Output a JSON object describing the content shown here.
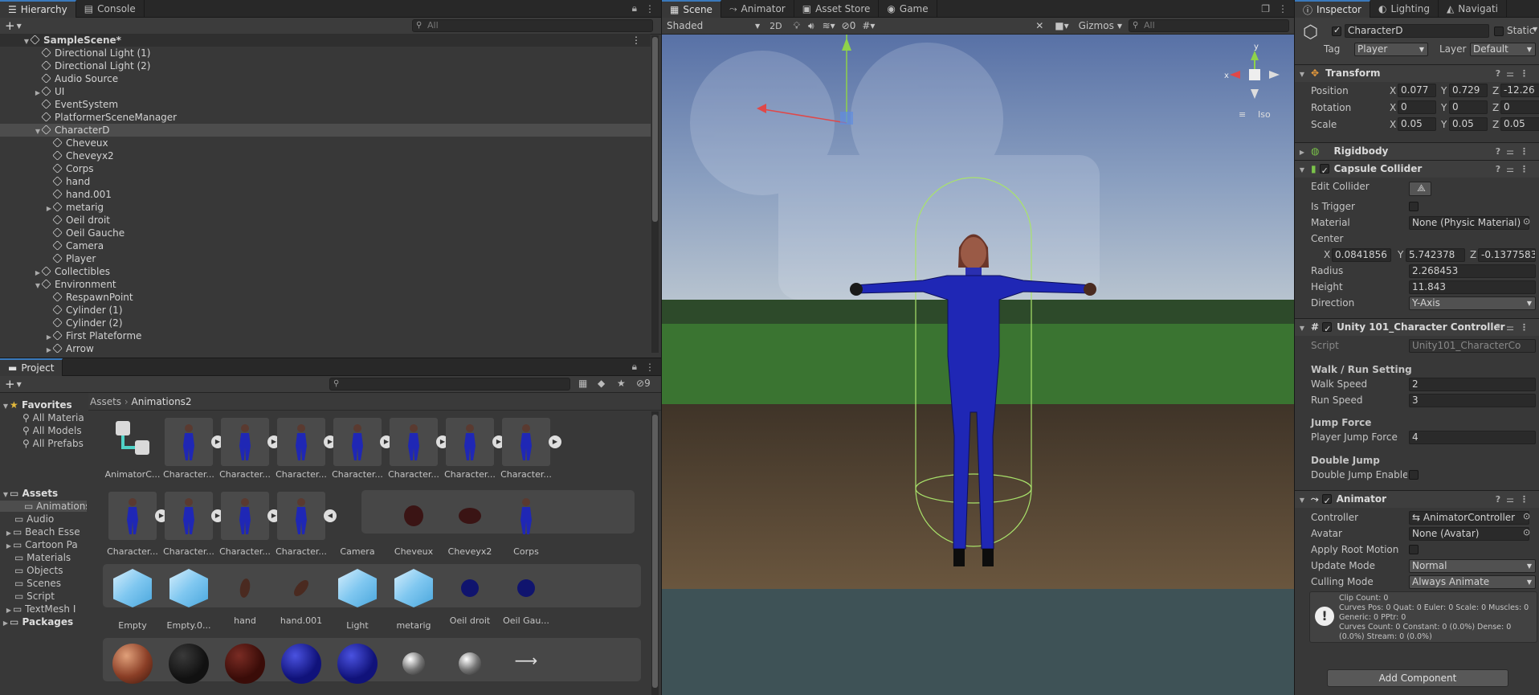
{
  "hierarchy": {
    "tabs": [
      "Hierarchy",
      "Console"
    ],
    "search_placeholder": "All",
    "items": [
      {
        "label": "SampleScene*",
        "indent": 0,
        "fold": "▼",
        "type": "scene"
      },
      {
        "label": "Directional Light (1)",
        "indent": 1,
        "fold": ""
      },
      {
        "label": "Directional Light (2)",
        "indent": 1,
        "fold": ""
      },
      {
        "label": "Audio Source",
        "indent": 1,
        "fold": ""
      },
      {
        "label": "UI",
        "indent": 1,
        "fold": "▶"
      },
      {
        "label": "EventSystem",
        "indent": 1,
        "fold": ""
      },
      {
        "label": "PlatformerSceneManager",
        "indent": 1,
        "fold": ""
      },
      {
        "label": "CharacterD",
        "indent": 1,
        "fold": "▼",
        "selected": true
      },
      {
        "label": "Cheveux",
        "indent": 2,
        "fold": ""
      },
      {
        "label": "Cheveyx2",
        "indent": 2,
        "fold": ""
      },
      {
        "label": "Corps",
        "indent": 2,
        "fold": ""
      },
      {
        "label": "hand",
        "indent": 2,
        "fold": ""
      },
      {
        "label": "hand.001",
        "indent": 2,
        "fold": ""
      },
      {
        "label": "metarig",
        "indent": 2,
        "fold": "▶"
      },
      {
        "label": "Oeil droit",
        "indent": 2,
        "fold": ""
      },
      {
        "label": "Oeil Gauche",
        "indent": 2,
        "fold": ""
      },
      {
        "label": "Camera",
        "indent": 2,
        "fold": ""
      },
      {
        "label": "Player",
        "indent": 2,
        "fold": ""
      },
      {
        "label": "Collectibles",
        "indent": 1,
        "fold": "▶"
      },
      {
        "label": "Environment",
        "indent": 1,
        "fold": "▼"
      },
      {
        "label": "RespawnPoint",
        "indent": 2,
        "fold": ""
      },
      {
        "label": "Cylinder (1)",
        "indent": 2,
        "fold": ""
      },
      {
        "label": "Cylinder (2)",
        "indent": 2,
        "fold": ""
      },
      {
        "label": "First Plateforme",
        "indent": 2,
        "fold": "▶"
      },
      {
        "label": "Arrow",
        "indent": 2,
        "fold": "▶"
      }
    ]
  },
  "project": {
    "tab": "Project",
    "hidden_count": "9",
    "favorites": {
      "title": "Favorites",
      "items": [
        "All Materia",
        "All Models",
        "All Prefabs"
      ]
    },
    "assets_tree": {
      "title": "Assets",
      "items": [
        "Animations",
        "Audio",
        "Beach Esse",
        "Cartoon Pa",
        "Materials",
        "Objects",
        "Scenes",
        "Script",
        "TextMesh I"
      ]
    },
    "packages": "Packages",
    "breadcrumb": [
      "Assets",
      "Animations2"
    ],
    "row1": [
      "AnimatorC...",
      "Character...",
      "Character...",
      "Character...",
      "Character...",
      "Character...",
      "Character...",
      "Character..."
    ],
    "row2": [
      "Character...",
      "Character...",
      "Character...",
      "Character...",
      "Camera",
      "Cheveux",
      "Cheveyx2",
      "Corps"
    ],
    "row3": [
      "Empty",
      "Empty.0...",
      "hand",
      "hand.001",
      "Light",
      "metarig",
      "Oeil droit",
      "Oeil Gau..."
    ]
  },
  "scene": {
    "tabs": [
      "Scene",
      "Animator",
      "Asset Store",
      "Game"
    ],
    "shading": "Shaded",
    "mode_2d": "2D",
    "hidden_count": "0",
    "gizmos": "Gizmos",
    "search_placeholder": "All",
    "view_label": "Iso",
    "axis_x": "x",
    "axis_y": "y"
  },
  "inspector": {
    "tabs": [
      "Inspector",
      "Lighting",
      "Navigati"
    ],
    "object_name": "CharacterD",
    "static_label": "Static",
    "tag_label": "Tag",
    "tag_value": "Player",
    "layer_label": "Layer",
    "layer_value": "Default",
    "transform": {
      "title": "Transform",
      "position": {
        "label": "Position",
        "x": "0.077",
        "y": "0.729",
        "z": "-12.26"
      },
      "rotation": {
        "label": "Rotation",
        "x": "0",
        "y": "0",
        "z": "0"
      },
      "scale": {
        "label": "Scale",
        "x": "0.05",
        "y": "0.05",
        "z": "0.05"
      }
    },
    "rigidbody": {
      "title": "Rigidbody"
    },
    "capsule": {
      "title": "Capsule Collider",
      "edit_label": "Edit Collider",
      "trigger_label": "Is Trigger",
      "material_label": "Material",
      "material_value": "None (Physic Material)",
      "center_label": "Center",
      "cx": "0.0841856",
      "cy": "5.742378",
      "cz": "-0.1377583",
      "radius_label": "Radius",
      "radius_value": "2.268453",
      "height_label": "Height",
      "height_value": "11.843",
      "direction_label": "Direction",
      "direction_value": "Y-Axis"
    },
    "controller": {
      "title": "Unity 101_Character Controller",
      "script_label": "Script",
      "script_value": "Unity101_CharacterCo",
      "walk_header": "Walk / Run Setting",
      "walk_label": "Walk Speed",
      "walk_value": "2",
      "run_label": "Run Speed",
      "run_value": "3",
      "jump_header": "Jump Force",
      "jump_label": "Player Jump Force",
      "jump_value": "4",
      "double_header": "Double Jump",
      "double_label": "Double Jump Enabled"
    },
    "animator": {
      "title": "Animator",
      "controller_label": "Controller",
      "controller_value": "AnimatorController",
      "avatar_label": "Avatar",
      "avatar_value": "None (Avatar)",
      "root_label": "Apply Root Motion",
      "update_label": "Update Mode",
      "update_value": "Normal",
      "culling_label": "Culling Mode",
      "culling_value": "Always Animate",
      "info": [
        "Clip Count: 0",
        "Curves Pos: 0 Quat: 0 Euler: 0 Scale: 0 Muscles: 0",
        "Generic: 0 PPtr: 0",
        "Curves Count: 0 Constant: 0 (0.0%) Dense: 0",
        "(0.0%) Stream: 0 (0.0%)"
      ]
    },
    "add_component": "Add Component",
    "axis_labels": {
      "x": "X",
      "y": "Y",
      "z": "Z"
    }
  }
}
